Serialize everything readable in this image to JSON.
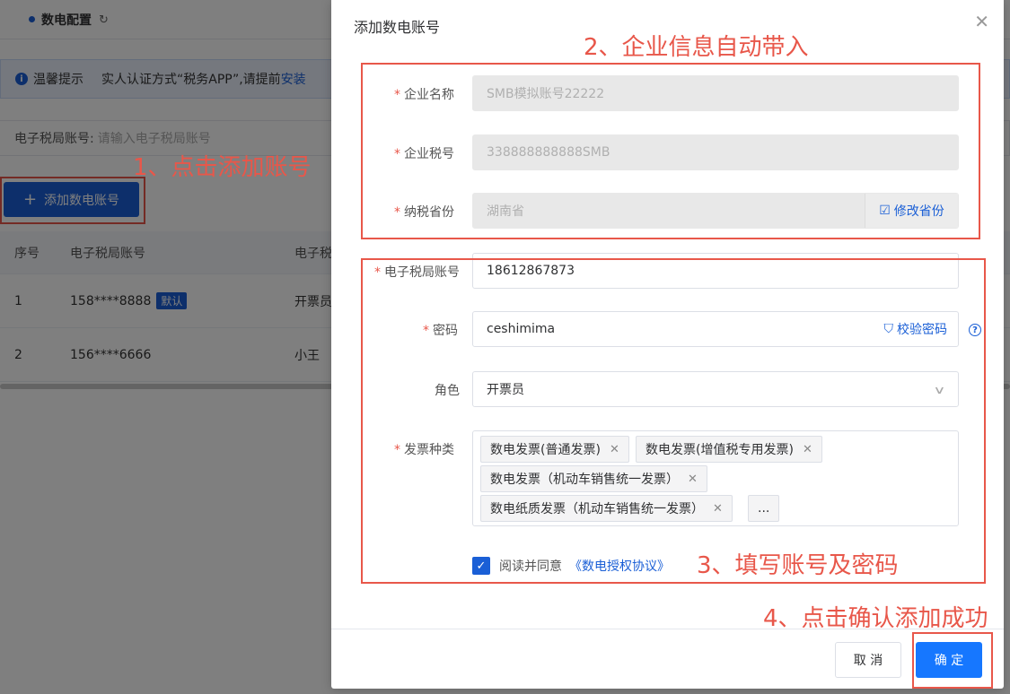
{
  "tabbar": {
    "active_tab": "数电配置"
  },
  "tip": {
    "title": "温馨提示",
    "text": "实人认证方式“税务APP”,请提前",
    "link": "安装"
  },
  "search": {
    "label": "电子税局账号:",
    "placeholder": "请输入电子税局账号"
  },
  "toolbar": {
    "add_button": "添加数电账号"
  },
  "table": {
    "headers": [
      "序号",
      "电子税局账号",
      "电子税"
    ],
    "rows": [
      {
        "index": "1",
        "account": "158****8888",
        "badge": "默认",
        "name": "开票员"
      },
      {
        "index": "2",
        "account": "156****6666",
        "badge": "",
        "name": "小王"
      }
    ]
  },
  "dialog": {
    "title": "添加数电账号",
    "fields": {
      "company_name": {
        "label": "企业名称",
        "value": "SMB模拟账号22222"
      },
      "tax_number": {
        "label": "企业税号",
        "value": "338888888888SMB"
      },
      "province": {
        "label": "纳税省份",
        "value": "湖南省",
        "action": "修改省份"
      },
      "account": {
        "label": "电子税局账号",
        "value": "18612867873"
      },
      "password": {
        "label": "密码",
        "value": "ceshimima",
        "action": "校验密码"
      },
      "role": {
        "label": "角色",
        "value": "开票员"
      },
      "invoice_types": {
        "label": "发票种类",
        "tags": [
          "数电发票(普通发票)",
          "数电发票(增值税专用发票)",
          "数电发票（机动车销售统一发票）",
          "数电纸质发票（机动车销售统一发票）"
        ],
        "more": "..."
      }
    },
    "agreement": {
      "text": "阅读并同意",
      "link": "《数电授权协议》"
    },
    "cancel_button": "取 消",
    "ok_button": "确 定"
  },
  "annotations": {
    "step1": "1、点击添加账号",
    "step2": "2、企业信息自动带入",
    "step3": "3、填写账号及密码",
    "step4": "4、点击确认添加成功"
  },
  "colors": {
    "primary": "#1a5fd6",
    "annotation": "#e8574a",
    "required": "#e8574a"
  }
}
